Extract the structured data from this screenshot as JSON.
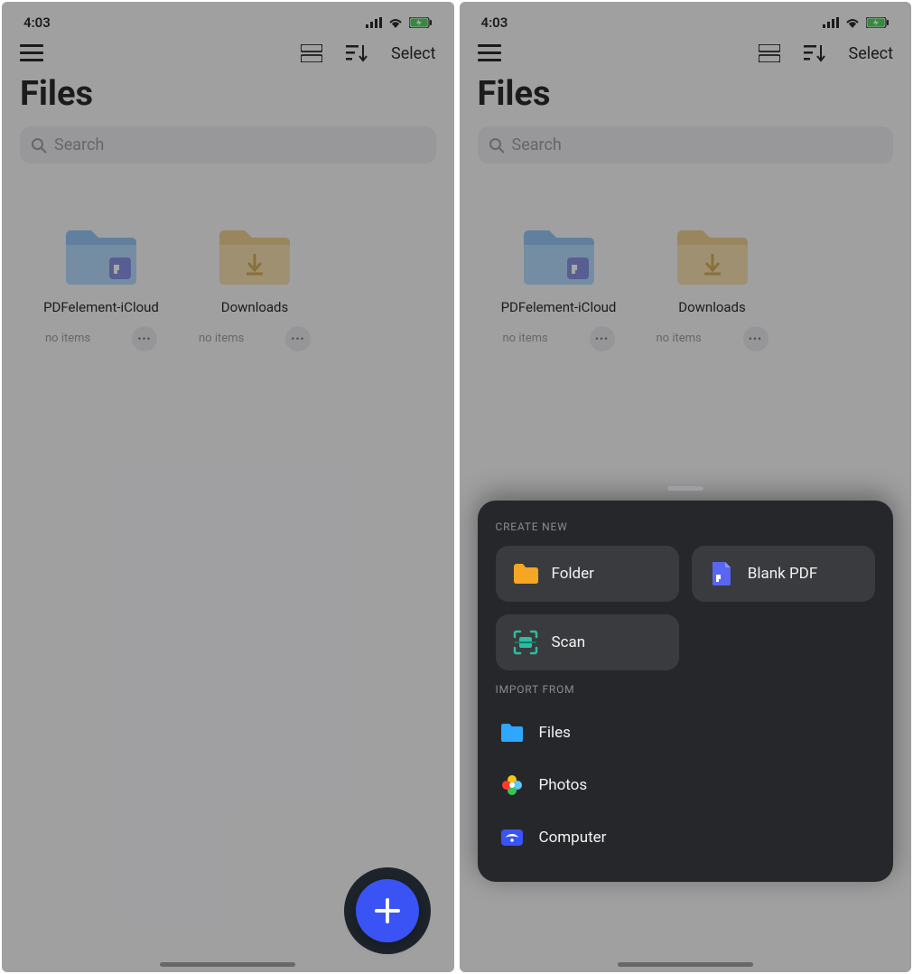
{
  "status": {
    "time": "4:03"
  },
  "toolbar": {
    "select_label": "Select"
  },
  "page_title": "Files",
  "search": {
    "placeholder": "Search"
  },
  "folders": [
    {
      "name": "PDFelement-iCloud",
      "subtitle": "no items"
    },
    {
      "name": "Downloads",
      "subtitle": "no items"
    }
  ],
  "sheet": {
    "create_heading": "CREATE NEW",
    "import_heading": "IMPORT FROM",
    "tiles": {
      "folder": "Folder",
      "blank_pdf": "Blank PDF",
      "scan": "Scan"
    },
    "import": {
      "files": "Files",
      "photos": "Photos",
      "computer": "Computer"
    }
  }
}
